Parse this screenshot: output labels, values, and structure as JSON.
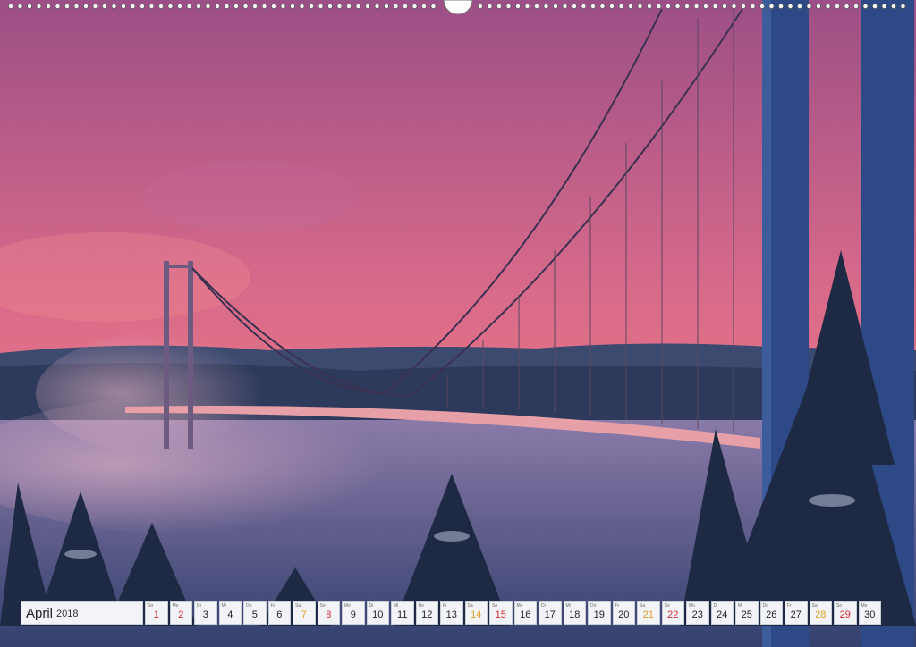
{
  "calendar": {
    "month": "April",
    "year": "2018",
    "days": [
      {
        "wd": "So",
        "n": "1",
        "type": "sun"
      },
      {
        "wd": "Mo",
        "n": "2",
        "type": "sun"
      },
      {
        "wd": "Di",
        "n": "3",
        "type": "week"
      },
      {
        "wd": "Mi",
        "n": "4",
        "type": "week"
      },
      {
        "wd": "Do",
        "n": "5",
        "type": "week"
      },
      {
        "wd": "Fr",
        "n": "6",
        "type": "week"
      },
      {
        "wd": "Sa",
        "n": "7",
        "type": "sat"
      },
      {
        "wd": "So",
        "n": "8",
        "type": "sun"
      },
      {
        "wd": "Mo",
        "n": "9",
        "type": "week"
      },
      {
        "wd": "Di",
        "n": "10",
        "type": "week"
      },
      {
        "wd": "Mi",
        "n": "11",
        "type": "week"
      },
      {
        "wd": "Do",
        "n": "12",
        "type": "week"
      },
      {
        "wd": "Fr",
        "n": "13",
        "type": "week"
      },
      {
        "wd": "Sa",
        "n": "14",
        "type": "sat"
      },
      {
        "wd": "So",
        "n": "15",
        "type": "sun"
      },
      {
        "wd": "Mo",
        "n": "16",
        "type": "week"
      },
      {
        "wd": "Di",
        "n": "17",
        "type": "week"
      },
      {
        "wd": "Mi",
        "n": "18",
        "type": "week"
      },
      {
        "wd": "Do",
        "n": "19",
        "type": "week"
      },
      {
        "wd": "Fr",
        "n": "20",
        "type": "week"
      },
      {
        "wd": "Sa",
        "n": "21",
        "type": "sat"
      },
      {
        "wd": "So",
        "n": "22",
        "type": "sun"
      },
      {
        "wd": "Mo",
        "n": "23",
        "type": "week"
      },
      {
        "wd": "Di",
        "n": "24",
        "type": "week"
      },
      {
        "wd": "Mi",
        "n": "25",
        "type": "week"
      },
      {
        "wd": "Do",
        "n": "26",
        "type": "week"
      },
      {
        "wd": "Fr",
        "n": "27",
        "type": "week"
      },
      {
        "wd": "Sa",
        "n": "28",
        "type": "sat"
      },
      {
        "wd": "So",
        "n": "29",
        "type": "sun"
      },
      {
        "wd": "Mo",
        "n": "30",
        "type": "week"
      }
    ]
  },
  "colors": {
    "sky_top": "#b85a86",
    "sky_bottom": "#f07a84",
    "water": "#4a5a8a",
    "sunday": "#d8242c",
    "saturday": "#e0a020"
  }
}
